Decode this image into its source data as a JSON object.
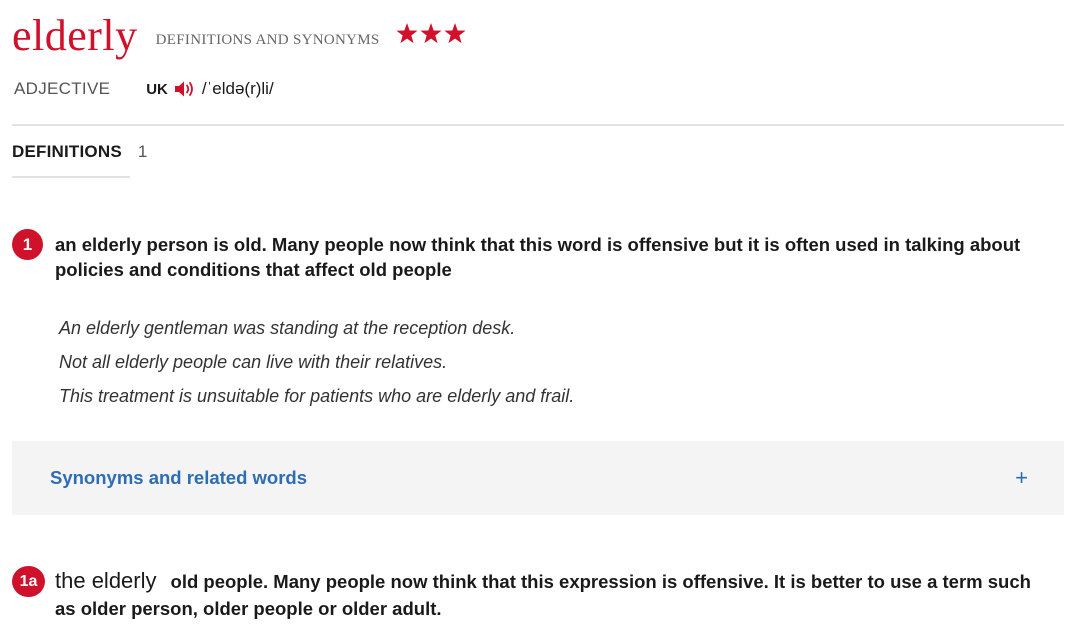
{
  "entry": {
    "headword": "elderly",
    "subtitle": "DEFINITIONS AND SYNONYMS",
    "star_count": 3,
    "part_of_speech": "ADJECTIVE",
    "region": "UK",
    "pronunciation": "/ˈeldə(r)li/"
  },
  "tab": {
    "label": "DEFINITIONS",
    "count": "1"
  },
  "sense1": {
    "number": "1",
    "definition": "an elderly person is old. Many people now think that this word is offensive but it is often used in talking about policies and conditions that affect old people",
    "examples": [
      "An elderly gentleman was standing at the reception desk.",
      "Not all elderly people can live with their relatives.",
      "This treatment is unsuitable for patients who are elderly and frail."
    ]
  },
  "synonyms": {
    "label": "Synonyms and related words",
    "expand_symbol": "+"
  },
  "sense1a": {
    "number": "1a",
    "phrase": "the elderly",
    "definition": "old people. Many people now think that this expression is offensive. It is better to use a term such as older person, older people or older adult."
  },
  "colors": {
    "brand_red": "#d0112b",
    "link_blue": "#2d6db5",
    "panel_bg": "#f4f4f4"
  },
  "icons": [
    "star-icon",
    "speaker-icon",
    "plus-icon"
  ]
}
